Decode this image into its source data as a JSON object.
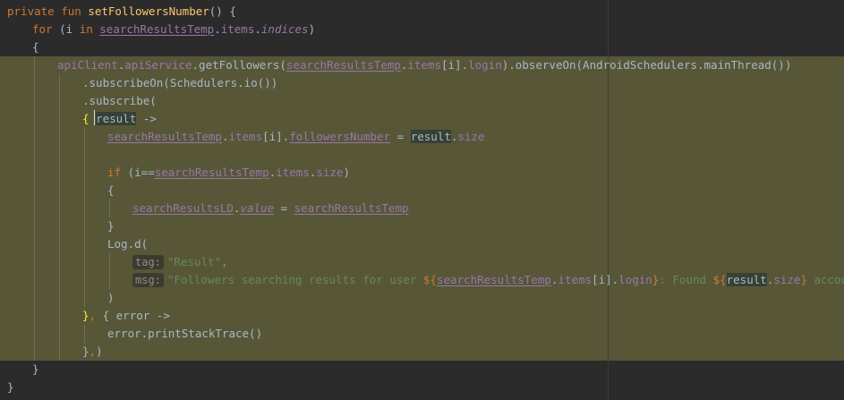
{
  "editor": {
    "lines": [
      {
        "indent": 0,
        "hl": false,
        "tokens": [
          {
            "t": "private fun ",
            "c": "kw"
          },
          {
            "t": "setFollowersNumber",
            "c": "fn"
          },
          {
            "t": "() {",
            "c": "pl"
          }
        ]
      },
      {
        "indent": 1,
        "hl": false,
        "tokens": [
          {
            "t": "for ",
            "c": "kw"
          },
          {
            "t": "(i ",
            "c": "pl"
          },
          {
            "t": "in ",
            "c": "kw"
          },
          {
            "t": "searchResultsTemp",
            "c": "prop ul"
          },
          {
            "t": ".",
            "c": "pl"
          },
          {
            "t": "items",
            "c": "prop"
          },
          {
            "t": ".",
            "c": "pl"
          },
          {
            "t": "indices",
            "c": "prop it"
          },
          {
            "t": ")",
            "c": "pl"
          }
        ]
      },
      {
        "indent": 1,
        "hl": false,
        "tokens": [
          {
            "t": "{",
            "c": "pl"
          }
        ]
      },
      {
        "indent": 2,
        "hl": true,
        "tokens": [
          {
            "t": "apiClient",
            "c": "prop"
          },
          {
            "t": ".",
            "c": "pl"
          },
          {
            "t": "apiService",
            "c": "prop"
          },
          {
            "t": ".getFollowers(",
            "c": "pl"
          },
          {
            "t": "searchResultsTemp",
            "c": "prop ul"
          },
          {
            "t": ".",
            "c": "pl"
          },
          {
            "t": "items",
            "c": "prop"
          },
          {
            "t": "[i].",
            "c": "pl"
          },
          {
            "t": "login",
            "c": "prop"
          },
          {
            "t": ").observeOn(AndroidSchedulers.mainThread())",
            "c": "pl"
          }
        ]
      },
      {
        "indent": 3,
        "hl": true,
        "tokens": [
          {
            "t": ".subscribeOn(Schedulers.io())",
            "c": "pl"
          }
        ]
      },
      {
        "indent": 3,
        "hl": true,
        "tokens": [
          {
            "t": ".subscribe(",
            "c": "pl"
          }
        ]
      },
      {
        "indent": 3,
        "hl": true,
        "tokens": [
          {
            "t": "{",
            "c": "brace-hl"
          },
          {
            "t": " ",
            "c": "pl"
          },
          {
            "t": "result",
            "c": "pl res"
          },
          {
            "t": " ->",
            "c": "pl"
          }
        ]
      },
      {
        "indent": 4,
        "hl": true,
        "tokens": [
          {
            "t": "searchResultsTemp",
            "c": "prop ul"
          },
          {
            "t": ".",
            "c": "pl"
          },
          {
            "t": "items",
            "c": "prop"
          },
          {
            "t": "[i].",
            "c": "pl"
          },
          {
            "t": "followersNumber",
            "c": "prop ul"
          },
          {
            "t": " = ",
            "c": "pl"
          },
          {
            "t": "result",
            "c": "pl res"
          },
          {
            "t": ".",
            "c": "pl"
          },
          {
            "t": "size",
            "c": "prop"
          }
        ]
      },
      {
        "indent": 4,
        "hl": true,
        "tokens": []
      },
      {
        "indent": 4,
        "hl": true,
        "tokens": [
          {
            "t": "if ",
            "c": "kw"
          },
          {
            "t": "(i==",
            "c": "pl"
          },
          {
            "t": "searchResultsTemp",
            "c": "prop ul"
          },
          {
            "t": ".",
            "c": "pl"
          },
          {
            "t": "items",
            "c": "prop"
          },
          {
            "t": ".",
            "c": "pl"
          },
          {
            "t": "size",
            "c": "prop"
          },
          {
            "t": ")",
            "c": "pl"
          }
        ]
      },
      {
        "indent": 4,
        "hl": true,
        "tokens": [
          {
            "t": "{",
            "c": "pl"
          }
        ]
      },
      {
        "indent": 5,
        "hl": true,
        "tokens": [
          {
            "t": "searchResultsLD",
            "c": "prop ul"
          },
          {
            "t": ".",
            "c": "pl"
          },
          {
            "t": "value",
            "c": "prop it ul"
          },
          {
            "t": " = ",
            "c": "pl"
          },
          {
            "t": "searchResultsTemp",
            "c": "prop ul"
          }
        ]
      },
      {
        "indent": 4,
        "hl": true,
        "tokens": [
          {
            "t": "}",
            "c": "pl"
          }
        ]
      },
      {
        "indent": 4,
        "hl": true,
        "tokens": [
          {
            "t": "Log.d(",
            "c": "pl"
          }
        ]
      },
      {
        "indent": 5,
        "hl": true,
        "tokens": [
          {
            "t": "tag:",
            "c": "hint"
          },
          {
            "t": "\"Result\"",
            "c": "str"
          },
          {
            "t": ",",
            "c": "kw"
          }
        ]
      },
      {
        "indent": 5,
        "hl": true,
        "tokens": [
          {
            "t": "msg:",
            "c": "hint"
          },
          {
            "t": "\"Followers searching results for user ",
            "c": "str"
          },
          {
            "t": "${",
            "c": "kw"
          },
          {
            "t": "searchResultsTemp",
            "c": "prop ul"
          },
          {
            "t": ".",
            "c": "pl"
          },
          {
            "t": "items",
            "c": "prop"
          },
          {
            "t": "[i].",
            "c": "pl"
          },
          {
            "t": "login",
            "c": "prop"
          },
          {
            "t": "}",
            "c": "kw"
          },
          {
            "t": ": Found ",
            "c": "str"
          },
          {
            "t": "${",
            "c": "kw"
          },
          {
            "t": "result",
            "c": "pl res"
          },
          {
            "t": ".",
            "c": "pl"
          },
          {
            "t": "size",
            "c": "prop"
          },
          {
            "t": "}",
            "c": "kw"
          },
          {
            "t": " accounts\"",
            "c": "str"
          }
        ]
      },
      {
        "indent": 4,
        "hl": true,
        "tokens": [
          {
            "t": ")",
            "c": "pl"
          }
        ]
      },
      {
        "indent": 3,
        "hl": true,
        "tokens": [
          {
            "t": "}",
            "c": "brace-hl"
          },
          {
            "t": ", ",
            "c": "kw"
          },
          {
            "t": "{ error ->",
            "c": "pl"
          }
        ]
      },
      {
        "indent": 4,
        "hl": true,
        "tokens": [
          {
            "t": "error.printStackTrace()",
            "c": "pl"
          }
        ]
      },
      {
        "indent": 3,
        "hl": true,
        "tokens": [
          {
            "t": "}",
            "c": "pl"
          },
          {
            "t": ",",
            "c": "kw"
          },
          {
            "t": ")",
            "c": "pl"
          }
        ]
      },
      {
        "indent": 1,
        "hl": false,
        "tokens": [
          {
            "t": "}",
            "c": "pl"
          }
        ]
      },
      {
        "indent": 0,
        "hl": false,
        "tokens": [
          {
            "t": "}",
            "c": "pl"
          }
        ]
      }
    ]
  }
}
